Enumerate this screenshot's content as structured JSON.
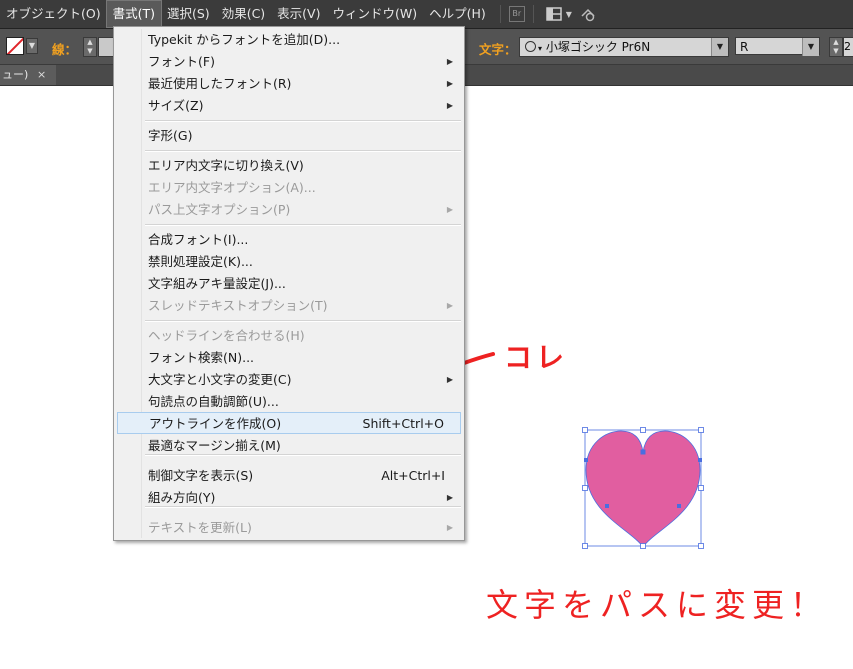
{
  "menubar": {
    "items": [
      {
        "label": "オブジェクト(O)",
        "active": false
      },
      {
        "label": "書式(T)",
        "active": true
      },
      {
        "label": "選択(S)",
        "active": false
      },
      {
        "label": "効果(C)",
        "active": false
      },
      {
        "label": "表示(V)",
        "active": false
      },
      {
        "label": "ウィンドウ(W)",
        "active": false
      },
      {
        "label": "ヘルプ(H)",
        "active": false
      }
    ],
    "br_label": "Br"
  },
  "controlbar": {
    "stroke_label": "線：",
    "text_label": "文字：",
    "font_name": "小塚ゴシック Pr6N",
    "font_style": "R",
    "size_partial": "2"
  },
  "tab": {
    "label": "ュー)",
    "close": "×"
  },
  "menu": {
    "items": [
      {
        "label": "Typekit からフォントを追加(D)...",
        "shortcut": "",
        "submenu": false,
        "disabled": false
      },
      {
        "label": "フォント(F)",
        "shortcut": "",
        "submenu": true,
        "disabled": false
      },
      {
        "label": "最近使用したフォント(R)",
        "shortcut": "",
        "submenu": true,
        "disabled": false
      },
      {
        "label": "サイズ(Z)",
        "shortcut": "",
        "submenu": true,
        "disabled": false
      },
      {
        "label": "字形(G)",
        "shortcut": "",
        "submenu": false,
        "disabled": false
      },
      {
        "label": "エリア内文字に切り換え(V)",
        "shortcut": "",
        "submenu": false,
        "disabled": false
      },
      {
        "label": "エリア内文字オプション(A)...",
        "shortcut": "",
        "submenu": false,
        "disabled": true
      },
      {
        "label": "パス上文字オプション(P)",
        "shortcut": "",
        "submenu": true,
        "disabled": true
      },
      {
        "label": "合成フォント(I)...",
        "shortcut": "",
        "submenu": false,
        "disabled": false
      },
      {
        "label": "禁則処理設定(K)...",
        "shortcut": "",
        "submenu": false,
        "disabled": false
      },
      {
        "label": "文字組みアキ量設定(J)...",
        "shortcut": "",
        "submenu": false,
        "disabled": false
      },
      {
        "label": "スレッドテキストオプション(T)",
        "shortcut": "",
        "submenu": true,
        "disabled": true
      },
      {
        "label": "ヘッドラインを合わせる(H)",
        "shortcut": "",
        "submenu": false,
        "disabled": true
      },
      {
        "label": "フォント検索(N)...",
        "shortcut": "",
        "submenu": false,
        "disabled": false
      },
      {
        "label": "大文字と小文字の変更(C)",
        "shortcut": "",
        "submenu": true,
        "disabled": false
      },
      {
        "label": "句読点の自動調節(U)...",
        "shortcut": "",
        "submenu": false,
        "disabled": false
      },
      {
        "label": "アウトラインを作成(O)",
        "shortcut": "Shift+Ctrl+O",
        "submenu": false,
        "disabled": false
      },
      {
        "label": "最適なマージン揃え(M)",
        "shortcut": "",
        "submenu": false,
        "disabled": false
      },
      {
        "label": "制御文字を表示(S)",
        "shortcut": "Alt+Ctrl+I",
        "submenu": false,
        "disabled": false
      },
      {
        "label": "組み方向(Y)",
        "shortcut": "",
        "submenu": true,
        "disabled": false
      },
      {
        "label": "テキストを更新(L)",
        "shortcut": "",
        "submenu": true,
        "disabled": true
      }
    ],
    "highlighted_index": 16
  },
  "annotations": {
    "pointer": "コレ",
    "caption": "文字をパスに変更！"
  },
  "colors": {
    "heart_fill": "#e15ea0",
    "selection": "#4a6ee0",
    "annotation": "#ee2222"
  }
}
